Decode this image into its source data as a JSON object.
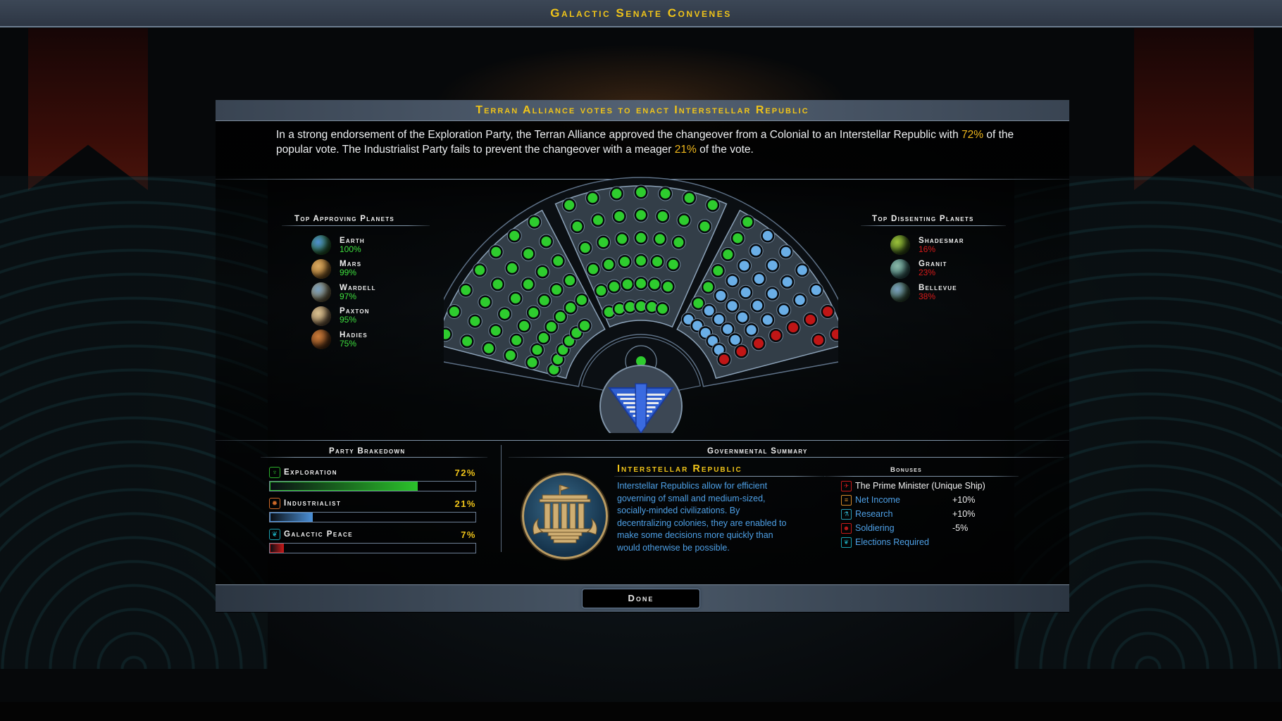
{
  "window": {
    "title": "Galactic Senate Convenes"
  },
  "headline": "Terran Alliance votes to enact Interstellar Republic",
  "summary": {
    "part1": "In a strong endorsement of the Exploration Party, the Terran Alliance approved the changeover from a Colonial to an Interstellar Republic with ",
    "pct1": "72%",
    "part2": " of the popular vote.  The Industrialist Party fails to prevent the changeover with a meager ",
    "pct2": "21%",
    "part3": " of the vote."
  },
  "approving": {
    "title": "Top Approving Planets",
    "planets": [
      {
        "name": "Earth",
        "pct": "100%",
        "color1": "#4f8fd0",
        "color2": "#2a6a2a"
      },
      {
        "name": "Mars",
        "pct": "99%",
        "color1": "#d8a860",
        "color2": "#9a6a2a"
      },
      {
        "name": "Wardell",
        "pct": "97%",
        "color1": "#7aa0c0",
        "color2": "#8a7a50"
      },
      {
        "name": "Paxton",
        "pct": "95%",
        "color1": "#d8c090",
        "color2": "#8a7050"
      },
      {
        "name": "Hadies",
        "pct": "75%",
        "color1": "#c87a3a",
        "color2": "#6a3a18"
      }
    ]
  },
  "dissenting": {
    "title": "Top Dissenting Planets",
    "planets": [
      {
        "name": "Shadesmar",
        "pct": "16%",
        "color1": "#9ac03a",
        "color2": "#3a5a1a"
      },
      {
        "name": "Granit",
        "pct": "23%",
        "color1": "#8ab8a8",
        "color2": "#3a6a6a"
      },
      {
        "name": "Bellevue",
        "pct": "38%",
        "color1": "#7aa0c0",
        "color2": "#3a5a3a"
      }
    ]
  },
  "chamber": {
    "colors": {
      "exploration": "#2ecc2e",
      "industrialist": "#6aaee6",
      "peace": "#c01616"
    },
    "wedges": [
      {
        "name": "left",
        "seats": {
          "exploration": 41,
          "industrialist": 0,
          "peace": 0
        }
      },
      {
        "name": "center",
        "seats": {
          "exploration": 38,
          "industrialist": 0,
          "peace": 0
        }
      },
      {
        "name": "right",
        "seats": {
          "exploration": 6,
          "industrialist": 29,
          "peace": 9
        }
      }
    ],
    "speaker": "exploration",
    "faction": "Terran Alliance"
  },
  "party_breakdown": {
    "title": "Party Brakedown",
    "parties": [
      {
        "name": "Exploration",
        "pct_label": "72%",
        "pct": 72,
        "color": "#2bc22b",
        "icon": "exploration-icon",
        "icon_color": "#2bb02b",
        "glyph": "♆"
      },
      {
        "name": "Industrialist",
        "pct_label": "21%",
        "pct": 21,
        "color": "#4b8fd6",
        "icon": "industrialist-icon",
        "icon_color": "#d06a28",
        "glyph": "✹"
      },
      {
        "name": "Galactic Peace",
        "pct_label": "7%",
        "pct": 7,
        "color": "#c01818",
        "icon": "galactic-peace-icon",
        "icon_color": "#1aa0b0",
        "glyph": "❦"
      }
    ]
  },
  "gov_summary": {
    "title": "Governmental Summary",
    "name": "Interstellar Republic",
    "description": "Interstellar Republics allow for efficient governing of small and medium-sized, socially-minded civilizations. By decentralizing colonies, they are enabled to make some decisions more quickly than would otherwise be possible.",
    "bonuses_title": "Bonuses",
    "bonuses": [
      {
        "label": "The Prime Minister (Unique Ship)",
        "value": "",
        "icon": "prime-minister-icon",
        "icon_color": "#c41a1a",
        "glyph": "✈",
        "white": true
      },
      {
        "label": "Net Income",
        "value": "+10%",
        "icon": "net-income-icon",
        "icon_color": "#d4892a",
        "glyph": "≡"
      },
      {
        "label": "Research",
        "value": "+10%",
        "icon": "research-icon",
        "icon_color": "#2a9ab0",
        "glyph": "⚗"
      },
      {
        "label": "Soldiering",
        "value": "-5%",
        "icon": "soldiering-icon",
        "icon_color": "#c41a1a",
        "glyph": "☻"
      },
      {
        "label": "Elections Required",
        "value": "",
        "icon": "elections-icon",
        "icon_color": "#1aa0b0",
        "glyph": "❦"
      }
    ]
  },
  "footer": {
    "done_label": "Done"
  }
}
